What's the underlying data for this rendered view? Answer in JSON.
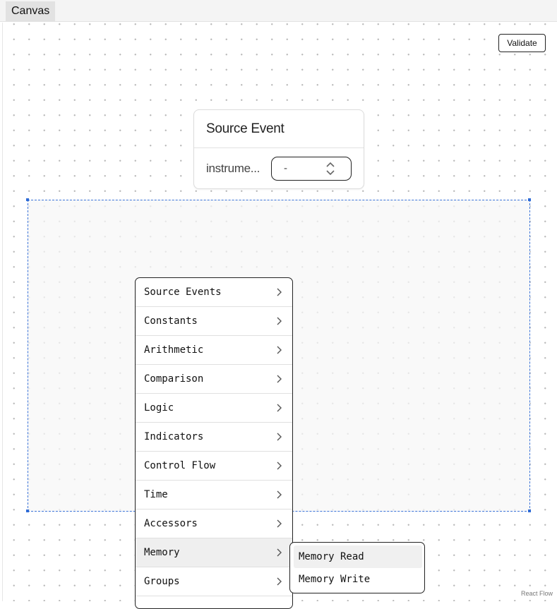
{
  "tab": {
    "label": "Canvas"
  },
  "toolbar": {
    "validate_label": "Validate"
  },
  "node": {
    "title": "Source Event",
    "field_label": "instrume...",
    "field_value": "-"
  },
  "context_menu": {
    "items": [
      {
        "label": "Source Events"
      },
      {
        "label": "Constants"
      },
      {
        "label": "Arithmetic"
      },
      {
        "label": "Comparison"
      },
      {
        "label": "Logic"
      },
      {
        "label": "Indicators"
      },
      {
        "label": "Control Flow"
      },
      {
        "label": "Time"
      },
      {
        "label": "Accessors"
      },
      {
        "label": "Memory"
      },
      {
        "label": "Groups"
      }
    ],
    "submenu": {
      "items": [
        {
          "label": "Memory Read"
        },
        {
          "label": "Memory Write"
        }
      ]
    }
  },
  "attribution": "React Flow",
  "colors": {
    "selection": "#3b73d8",
    "border": "#222222",
    "dots": "#b9b9b9"
  }
}
